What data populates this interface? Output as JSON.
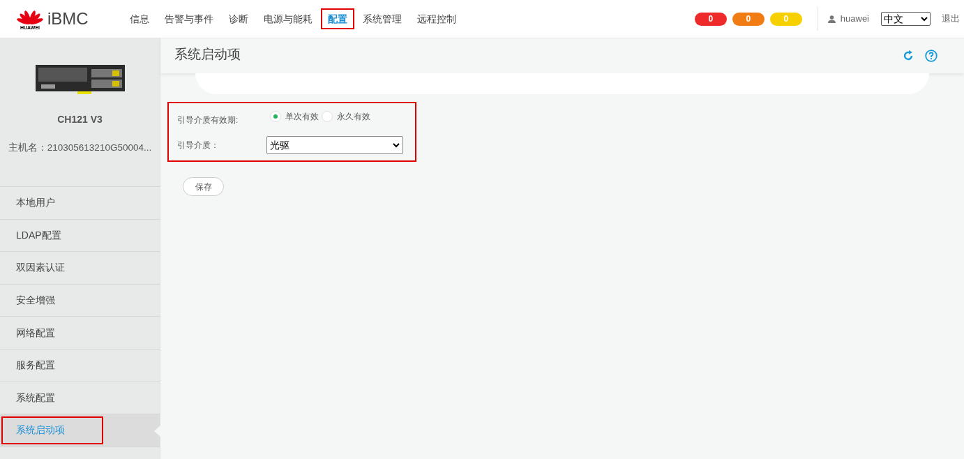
{
  "header": {
    "logo_caption": "HUAWEI",
    "product": "iBMC",
    "nav": [
      {
        "label": "信息",
        "selected": false,
        "highlighted": false
      },
      {
        "label": "告警与事件",
        "selected": false,
        "highlighted": false
      },
      {
        "label": "诊断",
        "selected": false,
        "highlighted": false
      },
      {
        "label": "电源与能耗",
        "selected": false,
        "highlighted": false
      },
      {
        "label": "配置",
        "selected": true,
        "highlighted": true
      },
      {
        "label": "系统管理",
        "selected": false,
        "highlighted": false
      },
      {
        "label": "远程控制",
        "selected": false,
        "highlighted": false
      }
    ],
    "alarms": [
      {
        "count": "0",
        "color": "#ee2a2a"
      },
      {
        "count": "0",
        "color": "#f27c14"
      },
      {
        "count": "0",
        "color": "#f6d000"
      }
    ],
    "user": "huawei",
    "language": "中文",
    "logout": "退出"
  },
  "sidebar": {
    "device_model": "CH121 V3",
    "hostname": "主机名：210305613210G50004...",
    "items": [
      {
        "label": "本地用户",
        "selected": false,
        "highlighted": false
      },
      {
        "label": "LDAP配置",
        "selected": false,
        "highlighted": false
      },
      {
        "label": "双因素认证",
        "selected": false,
        "highlighted": false
      },
      {
        "label": "安全增强",
        "selected": false,
        "highlighted": false
      },
      {
        "label": "网络配置",
        "selected": false,
        "highlighted": false
      },
      {
        "label": "服务配置",
        "selected": false,
        "highlighted": false
      },
      {
        "label": "系统配置",
        "selected": false,
        "highlighted": false
      },
      {
        "label": "系统启动项",
        "selected": true,
        "highlighted": true
      }
    ]
  },
  "main": {
    "title": "系统启动项",
    "form": {
      "highlighted": true,
      "validity_label": "引导介质有效期:",
      "validity_options": [
        {
          "label": "单次有效",
          "selected": true
        },
        {
          "label": "永久有效",
          "selected": false
        }
      ],
      "medium_label": "引导介质：",
      "medium_value": "光驱"
    },
    "save_button": "保存"
  }
}
